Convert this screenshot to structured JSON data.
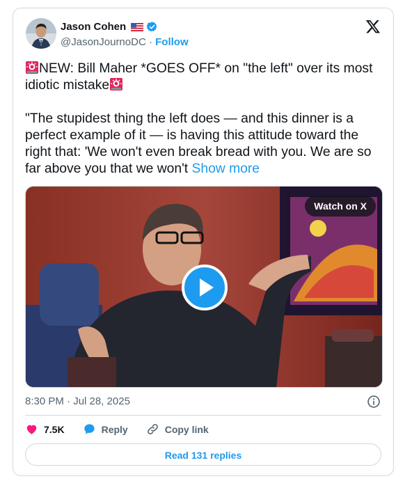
{
  "author": {
    "name": "Jason Cohen",
    "flag_icon": "us-flag-icon",
    "verified_icon": "verified-badge-icon",
    "handle": "@JasonJournoDC",
    "separator": "·",
    "follow_label": "Follow"
  },
  "brand_icon": "x-logo-icon",
  "tweet": {
    "emoji_icon": "rotating-light-emoji",
    "line1": "NEW: Bill Maher *GOES OFF* on \"the left\" over its most idiotic mistake",
    "line2": "\"The stupidest thing the left does — and this dinner is a perfect example of it — is having this attitude toward the right that: 'We won't even break bread with you. We are so far above you that we won't ",
    "show_more": "Show more"
  },
  "media": {
    "watch_label": "Watch on X",
    "play_icon": "play-icon"
  },
  "timestamp": "8:30 PM · Jul 28, 2025",
  "info_icon": "info-icon",
  "actions": {
    "likes": "7.5K",
    "reply_label": "Reply",
    "copy_label": "Copy link"
  },
  "read_replies": "Read 131 replies",
  "colors": {
    "accent": "#1d9bf0",
    "like": "#f91880",
    "text": "#0f1419",
    "muted": "#536471",
    "border": "#cfd9de"
  }
}
